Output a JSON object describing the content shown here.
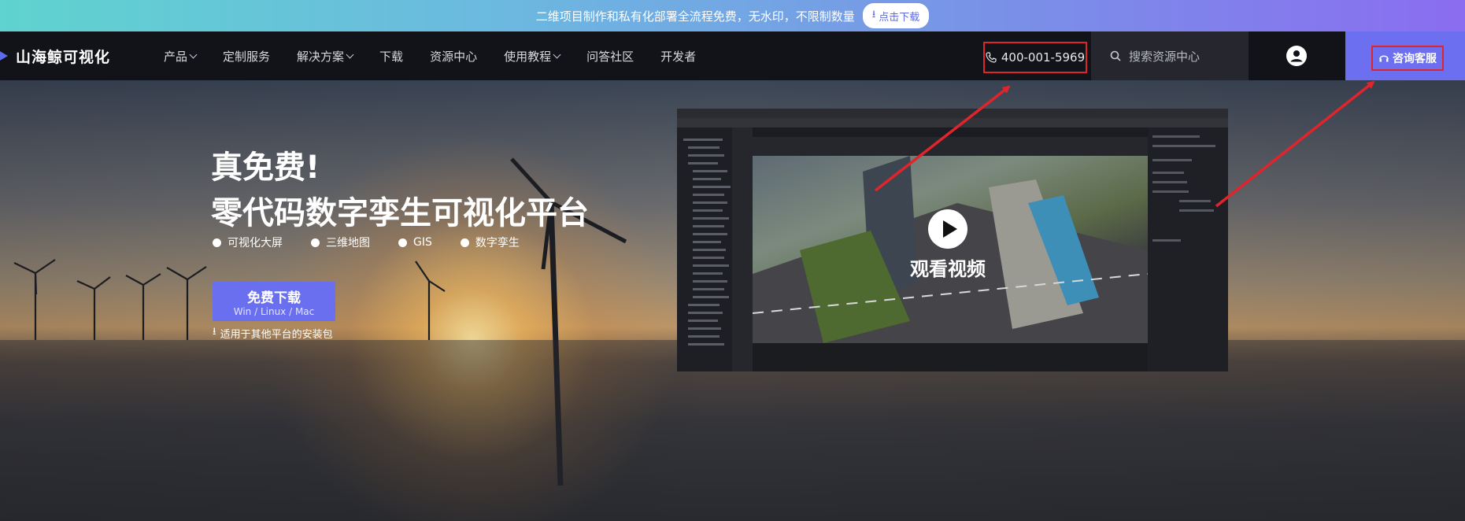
{
  "promo": {
    "text": "二维项目制作和私有化部署全流程免费，无水印，不限制数量",
    "button": "点击下载"
  },
  "brand": {
    "name": "山海鲸可视化"
  },
  "nav": {
    "items": [
      {
        "label": "产品",
        "dropdown": true
      },
      {
        "label": "定制服务",
        "dropdown": false
      },
      {
        "label": "解决方案",
        "dropdown": true
      },
      {
        "label": "下载",
        "dropdown": false
      },
      {
        "label": "资源中心",
        "dropdown": false
      },
      {
        "label": "使用教程",
        "dropdown": true
      },
      {
        "label": "问答社区",
        "dropdown": false
      },
      {
        "label": "开发者",
        "dropdown": false
      }
    ],
    "phone": "400-001-5969",
    "search_placeholder": "搜索资源中心",
    "consult": "咨询客服"
  },
  "hero": {
    "title_line1": "真免费!",
    "title_line2": "零代码数字孪生可视化平台",
    "features": [
      "可视化大屏",
      "三维地图",
      "GIS",
      "数字孪生"
    ],
    "download_main": "免费下载",
    "download_sub": "Win / Linux / Mac",
    "other_platforms": "适用于其他平台的安装包",
    "video_label": "观看视频"
  },
  "colors": {
    "accent": "#6b6ff0",
    "highlight_box": "#e0242c",
    "nav_bg": "#121318"
  }
}
